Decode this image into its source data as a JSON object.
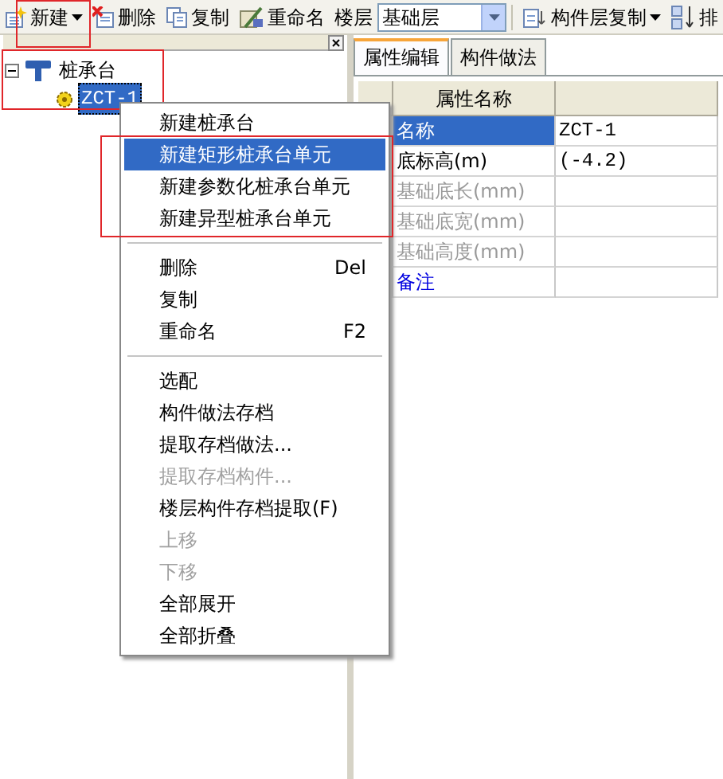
{
  "toolbar": {
    "items": [
      {
        "kind": "button",
        "label": "新建",
        "caret": true,
        "highlighted": true
      },
      {
        "kind": "button",
        "label": "删除",
        "caret": false,
        "highlighted": false
      },
      {
        "kind": "button",
        "label": "复制",
        "caret": false,
        "highlighted": false
      },
      {
        "kind": "button",
        "label": "重命名",
        "caret": false,
        "highlighted": false
      },
      {
        "kind": "label",
        "label": "楼层"
      },
      {
        "kind": "combo",
        "value": "基础层"
      },
      {
        "kind": "button",
        "label": "构件层复制",
        "caret": true,
        "highlighted": false
      },
      {
        "kind": "button",
        "label": "排",
        "caret": false,
        "highlighted": false
      }
    ]
  },
  "tree": {
    "highlighted": true,
    "items": [
      {
        "label": "桩承台",
        "expanded": true,
        "selected": false,
        "children": [
          {
            "label": "ZCT-1",
            "selected": true
          }
        ]
      }
    ]
  },
  "tabs": [
    {
      "label": "属性编辑",
      "selected": true
    },
    {
      "label": "构件做法",
      "selected": false
    }
  ],
  "grid": {
    "columns": [
      "属性名称"
    ],
    "rows": [
      {
        "kind": "text",
        "name": "名称",
        "value": "ZCT-1",
        "disabled": false,
        "selected": true
      },
      {
        "kind": "text",
        "name": "底标高(m)",
        "value": "(-4.2)",
        "disabled": false,
        "selected": false
      },
      {
        "kind": "text",
        "name": "基础底长(mm)",
        "disabled": true,
        "selected": false
      },
      {
        "kind": "text",
        "name": "基础底宽(mm)",
        "disabled": true,
        "selected": false
      },
      {
        "kind": "text",
        "name": "基础高度(mm)",
        "disabled": true,
        "selected": false
      },
      {
        "kind": "note",
        "name": "备注",
        "disabled": false,
        "selected": false
      }
    ]
  },
  "context_menu": {
    "items": [
      {
        "kind": "item",
        "label": "新建桩承台",
        "disabled": false,
        "selected": false,
        "highlighted": false
      },
      {
        "kind": "item",
        "label": "新建矩形桩承台单元",
        "disabled": false,
        "selected": true,
        "highlighted": true
      },
      {
        "kind": "item",
        "label": "新建参数化桩承台单元",
        "disabled": false,
        "selected": false,
        "highlighted": true
      },
      {
        "kind": "item",
        "label": "新建异型桩承台单元",
        "disabled": false,
        "selected": false,
        "highlighted": true
      },
      {
        "kind": "separator"
      },
      {
        "kind": "item",
        "label": "删除",
        "shortcut": "Del",
        "disabled": false,
        "selected": false,
        "highlighted": false
      },
      {
        "kind": "item",
        "label": "复制",
        "disabled": false,
        "selected": false,
        "highlighted": false
      },
      {
        "kind": "item",
        "label": "重命名",
        "shortcut": "F2",
        "disabled": false,
        "selected": false,
        "highlighted": false
      },
      {
        "kind": "separator"
      },
      {
        "kind": "item",
        "label": "选配",
        "disabled": false,
        "selected": false,
        "highlighted": false
      },
      {
        "kind": "item",
        "label": "构件做法存档",
        "disabled": false,
        "selected": false,
        "highlighted": false
      },
      {
        "kind": "item",
        "label": "提取存档做法...",
        "disabled": false,
        "selected": false,
        "highlighted": false
      },
      {
        "kind": "item",
        "label": "提取存档构件...",
        "disabled": true,
        "selected": false,
        "highlighted": false
      },
      {
        "kind": "item",
        "label": "楼层构件存档提取(F)",
        "disabled": false,
        "selected": false,
        "highlighted": false
      },
      {
        "kind": "item",
        "label": "上移",
        "disabled": true,
        "selected": false,
        "highlighted": false
      },
      {
        "kind": "item",
        "label": "下移",
        "disabled": true,
        "selected": false,
        "highlighted": false
      },
      {
        "kind": "item",
        "label": "全部展开",
        "disabled": false,
        "selected": false,
        "highlighted": false
      },
      {
        "kind": "item",
        "label": "全部折叠",
        "disabled": false,
        "selected": false,
        "highlighted": false
      }
    ]
  }
}
